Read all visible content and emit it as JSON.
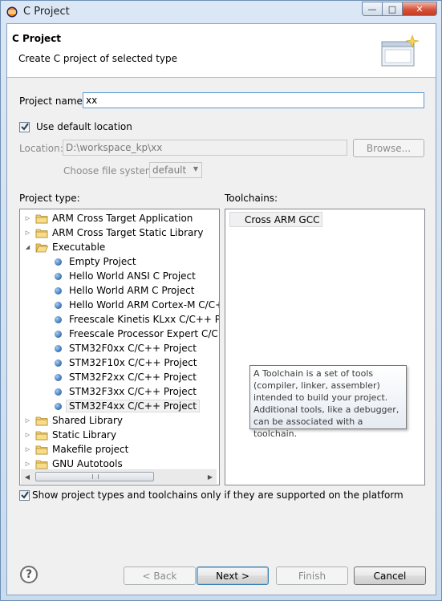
{
  "window": {
    "title": "C Project"
  },
  "header": {
    "title": "C Project",
    "description": "Create C project of selected type"
  },
  "project_name": {
    "label": "Project name:",
    "value": "xx"
  },
  "use_default_location": {
    "label": "Use default location",
    "checked": true
  },
  "location": {
    "label": "Location:",
    "value": "D:\\workspace_kp\\xx",
    "browse_label": "Browse..."
  },
  "file_system": {
    "label": "Choose file system:",
    "value": "default"
  },
  "project_type": {
    "label": "Project type:",
    "items": [
      {
        "label": "ARM Cross Target Application",
        "kind": "folder",
        "expanded": false,
        "level": 0
      },
      {
        "label": "ARM Cross Target Static Library",
        "kind": "folder",
        "expanded": false,
        "level": 0
      },
      {
        "label": "Executable",
        "kind": "folder",
        "expanded": true,
        "level": 0
      },
      {
        "label": "Empty Project",
        "kind": "item",
        "level": 1
      },
      {
        "label": "Hello World ANSI C Project",
        "kind": "item",
        "level": 1
      },
      {
        "label": "Hello World ARM C Project",
        "kind": "item",
        "level": 1
      },
      {
        "label": "Hello World ARM Cortex-M C/C++",
        "kind": "item",
        "level": 1
      },
      {
        "label": "Freescale Kinetis KLxx C/C++ Proje",
        "kind": "item",
        "level": 1
      },
      {
        "label": "Freescale Processor Expert C/C++ P",
        "kind": "item",
        "level": 1
      },
      {
        "label": "STM32F0xx C/C++ Project",
        "kind": "item",
        "level": 1
      },
      {
        "label": "STM32F10x C/C++ Project",
        "kind": "item",
        "level": 1
      },
      {
        "label": "STM32F2xx C/C++ Project",
        "kind": "item",
        "level": 1
      },
      {
        "label": "STM32F3xx C/C++ Project",
        "kind": "item",
        "level": 1
      },
      {
        "label": "STM32F4xx C/C++ Project",
        "kind": "item",
        "level": 1,
        "selected": true
      },
      {
        "label": "Shared Library",
        "kind": "folder",
        "expanded": false,
        "level": 0
      },
      {
        "label": "Static Library",
        "kind": "folder",
        "expanded": false,
        "level": 0
      },
      {
        "label": "Makefile project",
        "kind": "folder",
        "expanded": false,
        "level": 0
      },
      {
        "label": "GNU Autotools",
        "kind": "folder",
        "expanded": false,
        "level": 0
      }
    ]
  },
  "toolchains": {
    "label": "Toolchains:",
    "items": [
      "Cross ARM GCC"
    ],
    "tooltip": "A Toolchain is a set of tools\n(compiler, linker, assembler)\nintended to build your project.\nAdditional tools, like a debugger,\ncan be associated with a toolchain."
  },
  "show_supported": {
    "label": "Show project types and toolchains only if they are supported on the platform",
    "checked": true
  },
  "buttons": {
    "help": "?",
    "back": "< Back",
    "next": "Next >",
    "finish": "Finish",
    "cancel": "Cancel"
  }
}
